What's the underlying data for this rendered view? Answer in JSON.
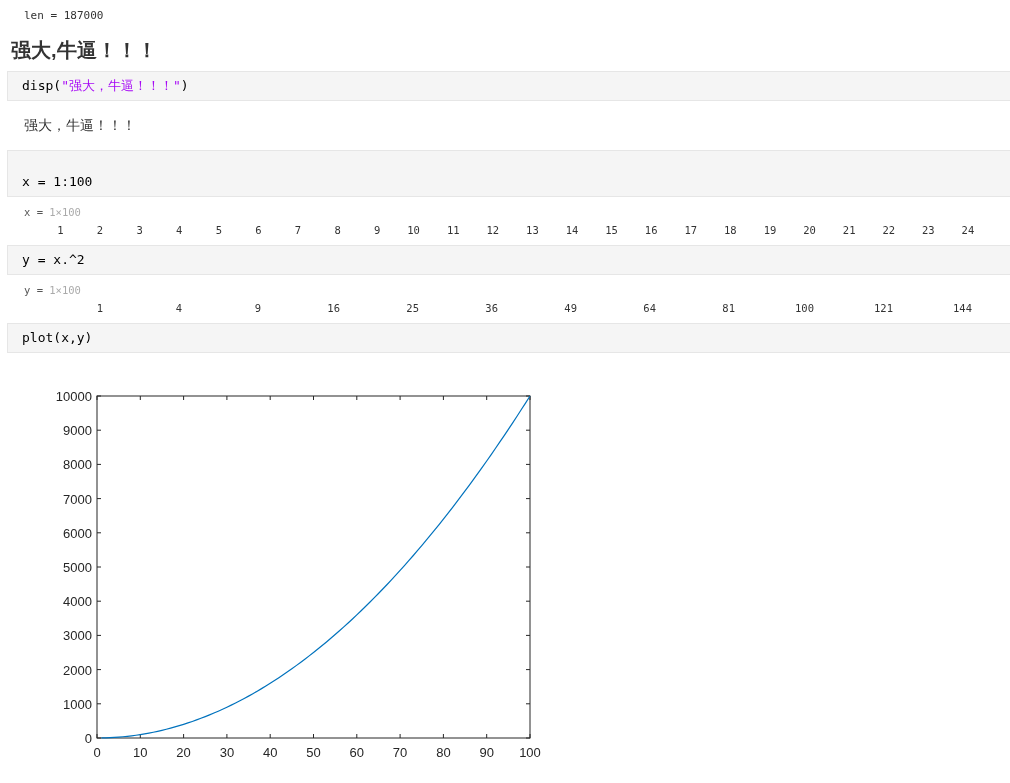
{
  "cells": [
    {
      "kind": "output_text",
      "text": "len = 187000"
    },
    {
      "kind": "heading",
      "text": "强大,牛逼！！！"
    },
    {
      "kind": "code",
      "blank_line_before": false,
      "tokens": [
        {
          "kind": "plain",
          "text": "disp("
        },
        {
          "kind": "string",
          "text": "\"强大，牛逼！！！\""
        },
        {
          "kind": "plain",
          "text": ")"
        }
      ]
    },
    {
      "kind": "display",
      "text": "强大，牛逼！！！"
    },
    {
      "kind": "code",
      "blank_line_before": true,
      "tokens": [
        {
          "kind": "plain",
          "text": "x = 1:100"
        }
      ]
    },
    {
      "kind": "array",
      "name": "x = ",
      "dims": "1×100",
      "values": [
        "1",
        "2",
        "3",
        "4",
        "5",
        "6",
        "7",
        "8",
        "9",
        "10",
        "11",
        "12",
        "13",
        "14",
        "15",
        "16",
        "17",
        "18",
        "19",
        "20",
        "21",
        "22",
        "23",
        "24"
      ]
    },
    {
      "kind": "code",
      "blank_line_before": false,
      "tokens": [
        {
          "kind": "plain",
          "text": "y = x.^2"
        }
      ]
    },
    {
      "kind": "array",
      "name": "y = ",
      "dims": "1×100",
      "values": [
        "1",
        "4",
        "9",
        "16",
        "25",
        "36",
        "49",
        "64",
        "81",
        "100",
        "121",
        "144"
      ]
    },
    {
      "kind": "code",
      "blank_line_before": false,
      "tokens": [
        {
          "kind": "plain",
          "text": "plot(x,y)"
        }
      ]
    },
    {
      "kind": "figure",
      "chart_data": {
        "type": "line",
        "x": [
          1,
          2,
          3,
          4,
          5,
          6,
          7,
          8,
          9,
          10,
          11,
          12,
          13,
          14,
          15,
          16,
          17,
          18,
          19,
          20,
          21,
          22,
          23,
          24,
          25,
          26,
          27,
          28,
          29,
          30,
          31,
          32,
          33,
          34,
          35,
          36,
          37,
          38,
          39,
          40,
          41,
          42,
          43,
          44,
          45,
          46,
          47,
          48,
          49,
          50,
          51,
          52,
          53,
          54,
          55,
          56,
          57,
          58,
          59,
          60,
          61,
          62,
          63,
          64,
          65,
          66,
          67,
          68,
          69,
          70,
          71,
          72,
          73,
          74,
          75,
          76,
          77,
          78,
          79,
          80,
          81,
          82,
          83,
          84,
          85,
          86,
          87,
          88,
          89,
          90,
          91,
          92,
          93,
          94,
          95,
          96,
          97,
          98,
          99,
          100
        ],
        "series": [
          {
            "color": "#0072bd",
            "values": [
              1,
              4,
              9,
              16,
              25,
              36,
              49,
              64,
              81,
              100,
              121,
              144,
              169,
              196,
              225,
              256,
              289,
              324,
              361,
              400,
              441,
              484,
              529,
              576,
              625,
              676,
              729,
              784,
              841,
              900,
              961,
              1024,
              1089,
              1156,
              1225,
              1296,
              1369,
              1444,
              1521,
              1600,
              1681,
              1764,
              1849,
              1936,
              2025,
              2116,
              2209,
              2304,
              2401,
              2500,
              2601,
              2704,
              2809,
              2916,
              3025,
              3136,
              3249,
              3364,
              3481,
              3600,
              3721,
              3844,
              3969,
              4096,
              4225,
              4356,
              4489,
              4624,
              4761,
              4900,
              5041,
              5184,
              5329,
              5476,
              5625,
              5776,
              5929,
              6084,
              6241,
              6400,
              6561,
              6724,
              6889,
              7056,
              7225,
              7396,
              7569,
              7744,
              7921,
              8100,
              8281,
              8464,
              8649,
              8836,
              9025,
              9216,
              9409,
              9604,
              9801,
              10000
            ]
          }
        ],
        "xlim": [
          0,
          100
        ],
        "ylim": [
          0,
          10000
        ],
        "xticks": [
          0,
          10,
          20,
          30,
          40,
          50,
          60,
          70,
          80,
          90,
          100
        ],
        "yticks": [
          0,
          1000,
          2000,
          3000,
          4000,
          5000,
          6000,
          7000,
          8000,
          9000,
          10000
        ]
      }
    }
  ]
}
